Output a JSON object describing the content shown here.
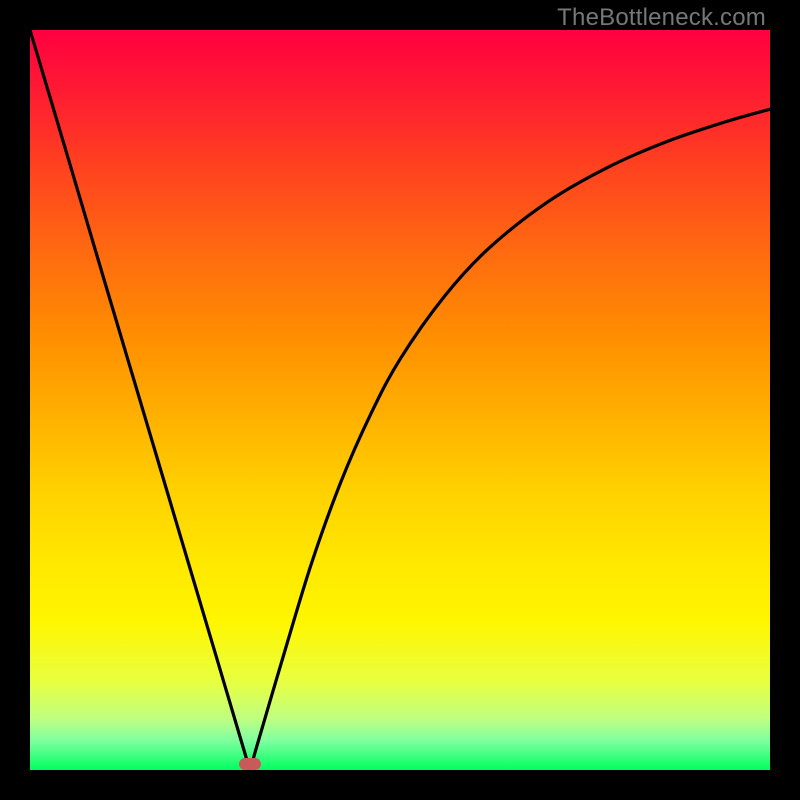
{
  "watermark": "TheBottleneck.com",
  "marker": {
    "x_frac": 0.297,
    "y_frac": 0.992
  },
  "chart_data": {
    "type": "line",
    "title": "",
    "xlabel": "",
    "ylabel": "",
    "xlim": [
      0,
      1
    ],
    "ylim": [
      0,
      1
    ],
    "background": "vertical-gradient red→yellow→green",
    "series": [
      {
        "name": "curve",
        "x": [
          0.0,
          0.05,
          0.1,
          0.15,
          0.2,
          0.25,
          0.29,
          0.297,
          0.305,
          0.34,
          0.38,
          0.42,
          0.46,
          0.5,
          0.56,
          0.62,
          0.7,
          0.78,
          0.86,
          0.94,
          1.0
        ],
        "y": [
          1.0,
          0.832,
          0.663,
          0.495,
          0.327,
          0.159,
          0.024,
          0.0,
          0.027,
          0.146,
          0.278,
          0.389,
          0.48,
          0.555,
          0.64,
          0.705,
          0.768,
          0.814,
          0.849,
          0.876,
          0.893
        ]
      }
    ],
    "annotations": [
      {
        "type": "marker",
        "shape": "pill",
        "color": "#c85a5a",
        "x": 0.297,
        "y": 0.006
      }
    ]
  }
}
